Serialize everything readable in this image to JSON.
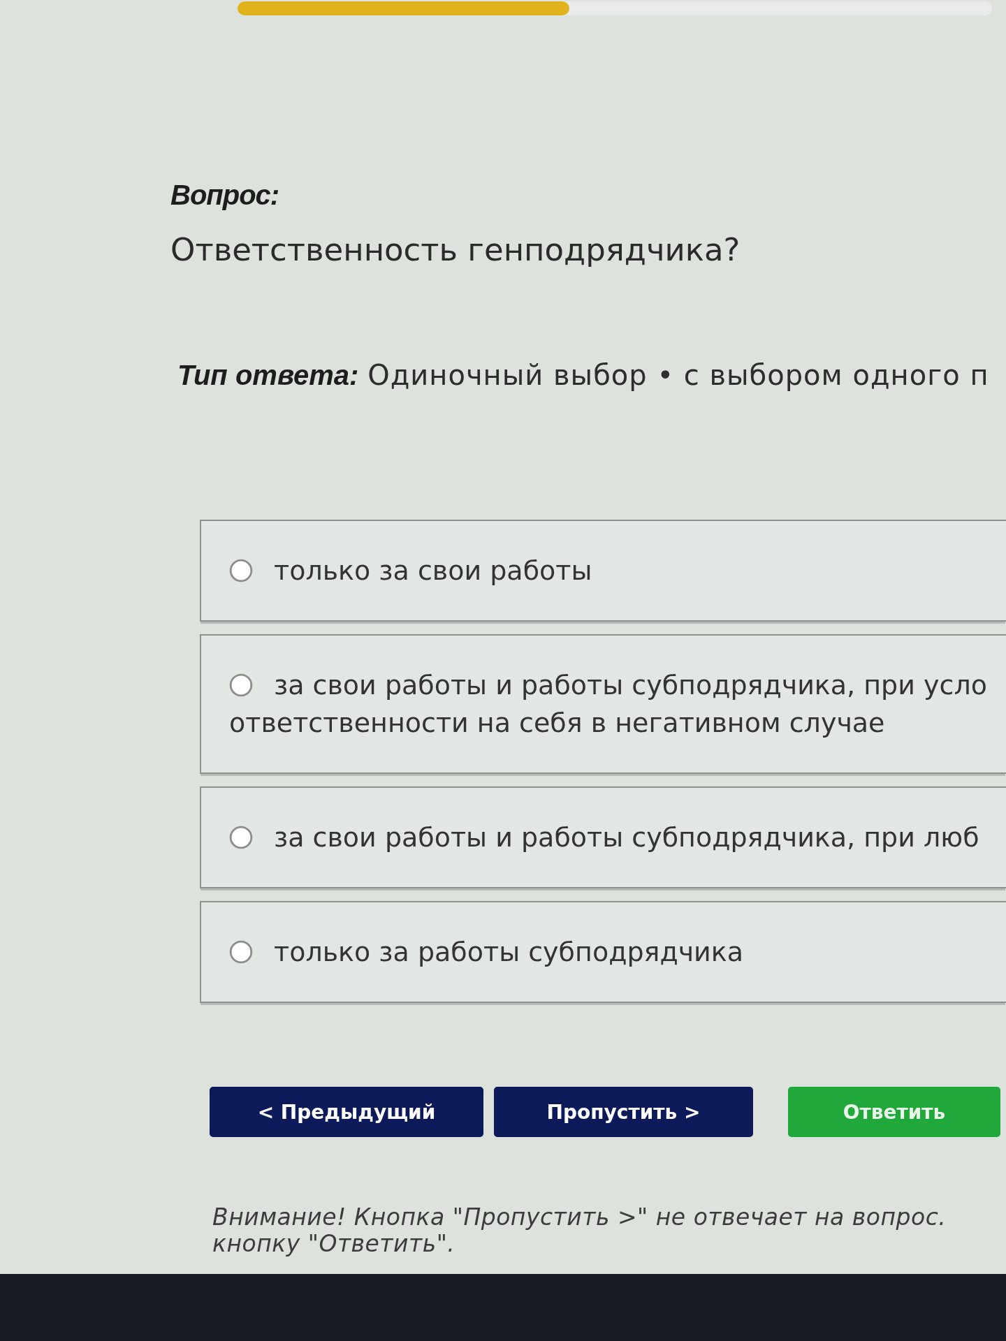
{
  "progress": {
    "level": 0.44
  },
  "question": {
    "heading": "Вопрос:",
    "text": "Ответственность генподрядчика?"
  },
  "answer_type": {
    "label": "Тип ответа:",
    "value": "Одиночный выбор • с выбором одного п"
  },
  "options": [
    {
      "lines": [
        "только за свои работы"
      ],
      "selected": false
    },
    {
      "lines": [
        "за свои работы и работы субподрядчика, при усло",
        "ответственности на себя в негативном случае"
      ],
      "selected": false
    },
    {
      "lines": [
        "за свои работы и работы субподрядчика, при люб"
      ],
      "selected": false
    },
    {
      "lines": [
        "только за работы субподрядчика"
      ],
      "selected": false
    }
  ],
  "buttons": [
    {
      "label": "< Предыдущий",
      "kind": "nav"
    },
    {
      "label": "Пропустить >",
      "kind": "nav"
    },
    {
      "label": "Ответить",
      "kind": "submit"
    }
  ],
  "warning": {
    "lines": [
      "Внимание! Кнопка \"Пропустить >\" не отвечает на вопрос.",
      "кнопку \"Ответить\"."
    ]
  }
}
